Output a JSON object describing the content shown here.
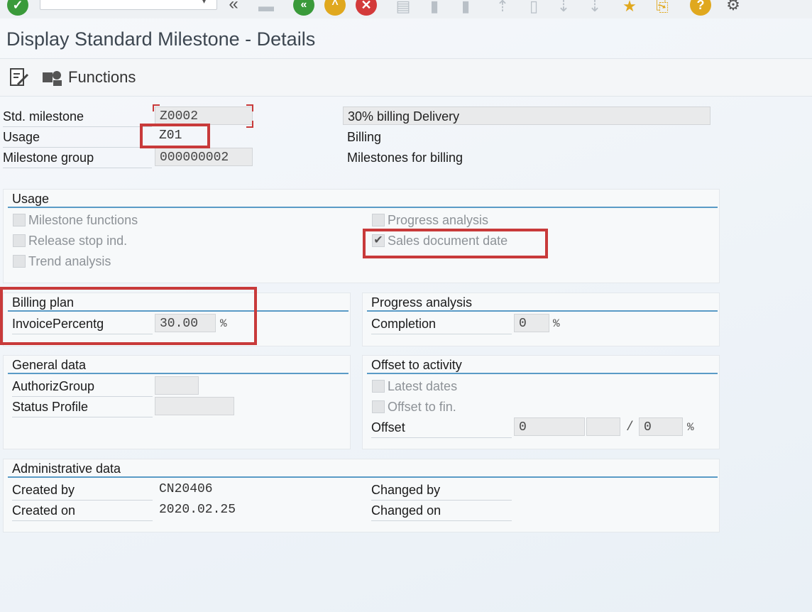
{
  "toolbar": {
    "icons": [
      "enter-icon",
      "back-double-icon",
      "save-icon",
      "back-icon",
      "exit-icon",
      "cancel-icon",
      "print-icon",
      "find-icon",
      "find-next-icon",
      "first-page-icon",
      "previous-page-icon",
      "next-page-icon",
      "last-page-icon",
      "create-session-icon",
      "shortcut-icon",
      "help-icon",
      "settings-icon"
    ]
  },
  "title": "Display Standard Milestone - Details",
  "functions_label": "Functions",
  "header": {
    "std_milestone_label": "Std. milestone",
    "std_milestone_value": "Z0002",
    "std_milestone_desc": "30% billing Delivery",
    "usage_label": "Usage",
    "usage_value": "Z01",
    "usage_desc": "Billing",
    "milestone_group_label": "Milestone group",
    "milestone_group_value": "000000002",
    "milestone_group_desc": "Milestones for billing"
  },
  "usage_group": {
    "title": "Usage",
    "milestone_functions": "Milestone functions",
    "release_stop": "Release stop ind.",
    "trend_analysis": "Trend analysis",
    "progress_analysis": "Progress analysis",
    "sales_document_date": "Sales document date"
  },
  "billing_plan": {
    "title": "Billing plan",
    "invoice_label": "InvoicePercentg",
    "invoice_value": "30.00",
    "unit": "%"
  },
  "progress_analysis": {
    "title": "Progress analysis",
    "completion_label": "Completion",
    "completion_value": "0",
    "unit": "%"
  },
  "general_data": {
    "title": "General data",
    "authoriz_label": "AuthorizGroup",
    "status_profile_label": "Status Profile"
  },
  "offset_activity": {
    "title": "Offset to activity",
    "latest_dates": "Latest dates",
    "offset_to_fin": "Offset to fin.",
    "offset_label": "Offset",
    "offset_value": "0",
    "slash": "/",
    "offset_value2": "0",
    "unit": "%"
  },
  "admin_data": {
    "title": "Administrative data",
    "created_by_label": "Created by",
    "created_by_value": "CN20406",
    "created_on_label": "Created on",
    "created_on_value": "2020.02.25",
    "changed_by_label": "Changed by",
    "changed_on_label": "Changed on"
  },
  "colors": {
    "highlight": "#c83a3a",
    "group_line": "#5a9bc6"
  }
}
